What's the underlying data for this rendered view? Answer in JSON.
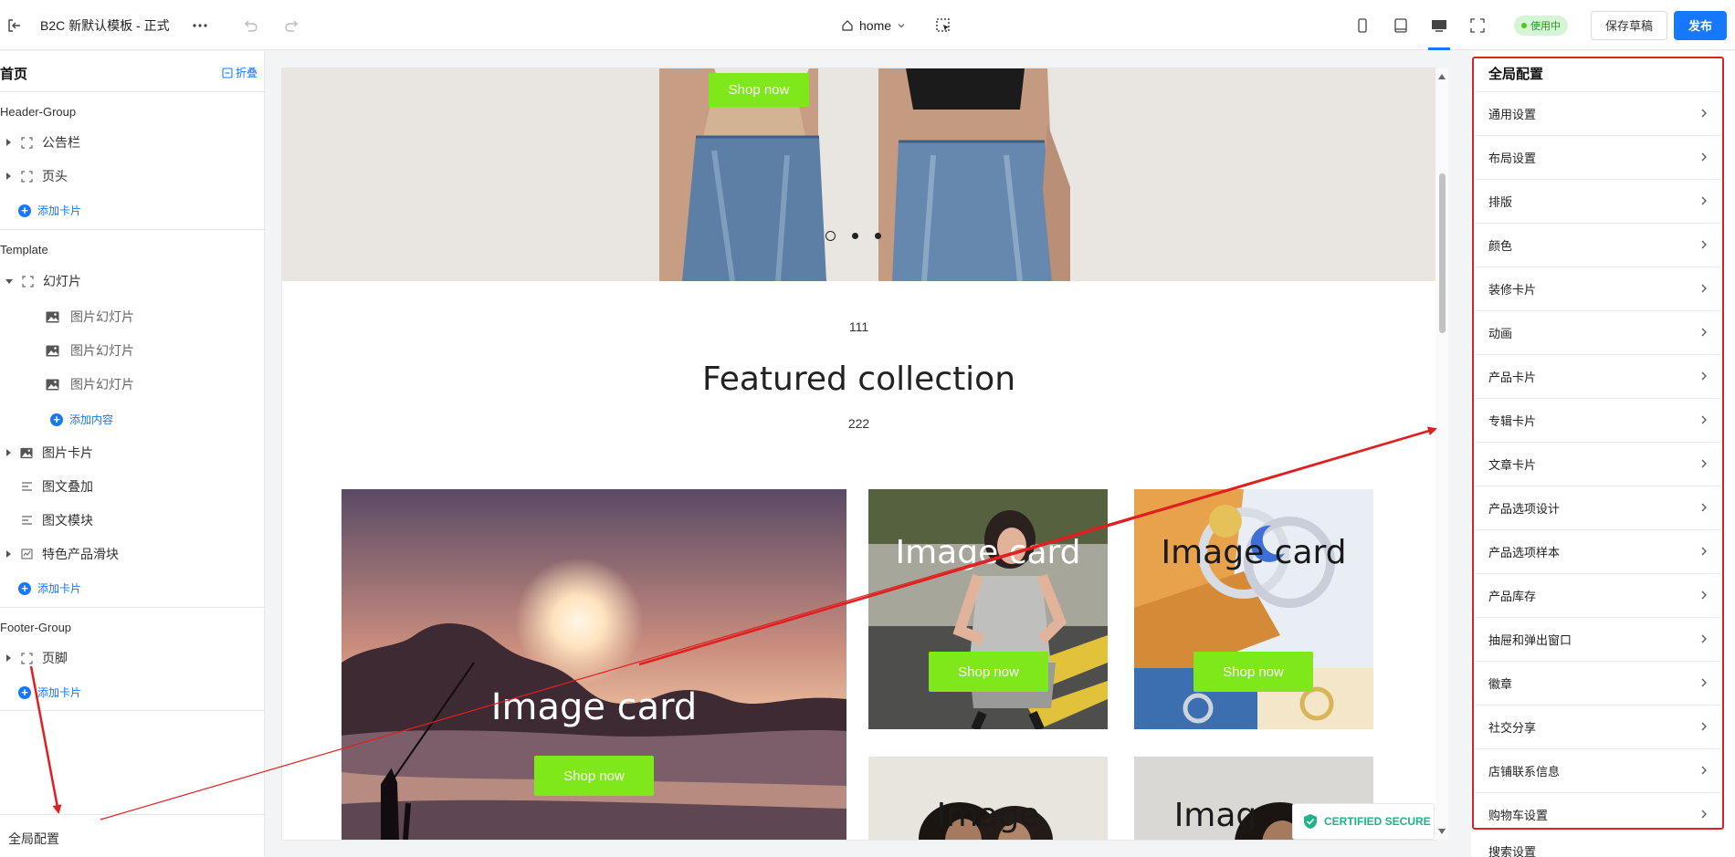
{
  "topbar": {
    "title": "B2C 新默认模板 - 正式",
    "page_select": "home",
    "status_badge": "使用中",
    "save_draft": "保存草稿",
    "publish": "发布"
  },
  "left": {
    "title": "首页",
    "fold": "折叠",
    "header_group": {
      "label": "Header-Group",
      "items": [
        "公告栏",
        "页头"
      ],
      "add": "添加卡片"
    },
    "template": {
      "label": "Template",
      "slideshow": "幻灯片",
      "slides": [
        "图片幻灯片",
        "图片幻灯片",
        "图片幻灯片"
      ],
      "add_content": "添加内容",
      "items": [
        "图片卡片",
        "图文叠加",
        "图文模块",
        "特色产品滑块"
      ],
      "add": "添加卡片"
    },
    "footer_group": {
      "label": "Footer-Group",
      "items": [
        "页脚"
      ],
      "add": "添加卡片"
    },
    "footer": "全局配置"
  },
  "preview": {
    "hero_button": "Shop now",
    "subheading": "111",
    "title": "Featured collection",
    "description": "222",
    "cards": [
      {
        "title": "Image card",
        "button": "Shop now"
      },
      {
        "title": "Image card",
        "button": "Shop now"
      },
      {
        "title": "Image card",
        "button": "Shop now"
      },
      {
        "title": "Image",
        "button": ""
      },
      {
        "title": "Imag",
        "button": ""
      }
    ],
    "secure_badge": "CERTIFIED SECURE"
  },
  "right": {
    "title": "全局配置",
    "items": [
      "通用设置",
      "布局设置",
      "排版",
      "颜色",
      "装修卡片",
      "动画",
      "产品卡片",
      "专辑卡片",
      "文章卡片",
      "产品选项设计",
      "产品选项样本",
      "产品库存",
      "抽屉和弹出窗口",
      "徽章",
      "社交分享",
      "店铺联系信息",
      "购物车设置"
    ],
    "cut_item": "搜索设置"
  },
  "colors": {
    "accent": "#1677ff",
    "shop_button": "#7ee81a",
    "annotation": "#e02020",
    "badge_bg": "#d6f5d6"
  }
}
